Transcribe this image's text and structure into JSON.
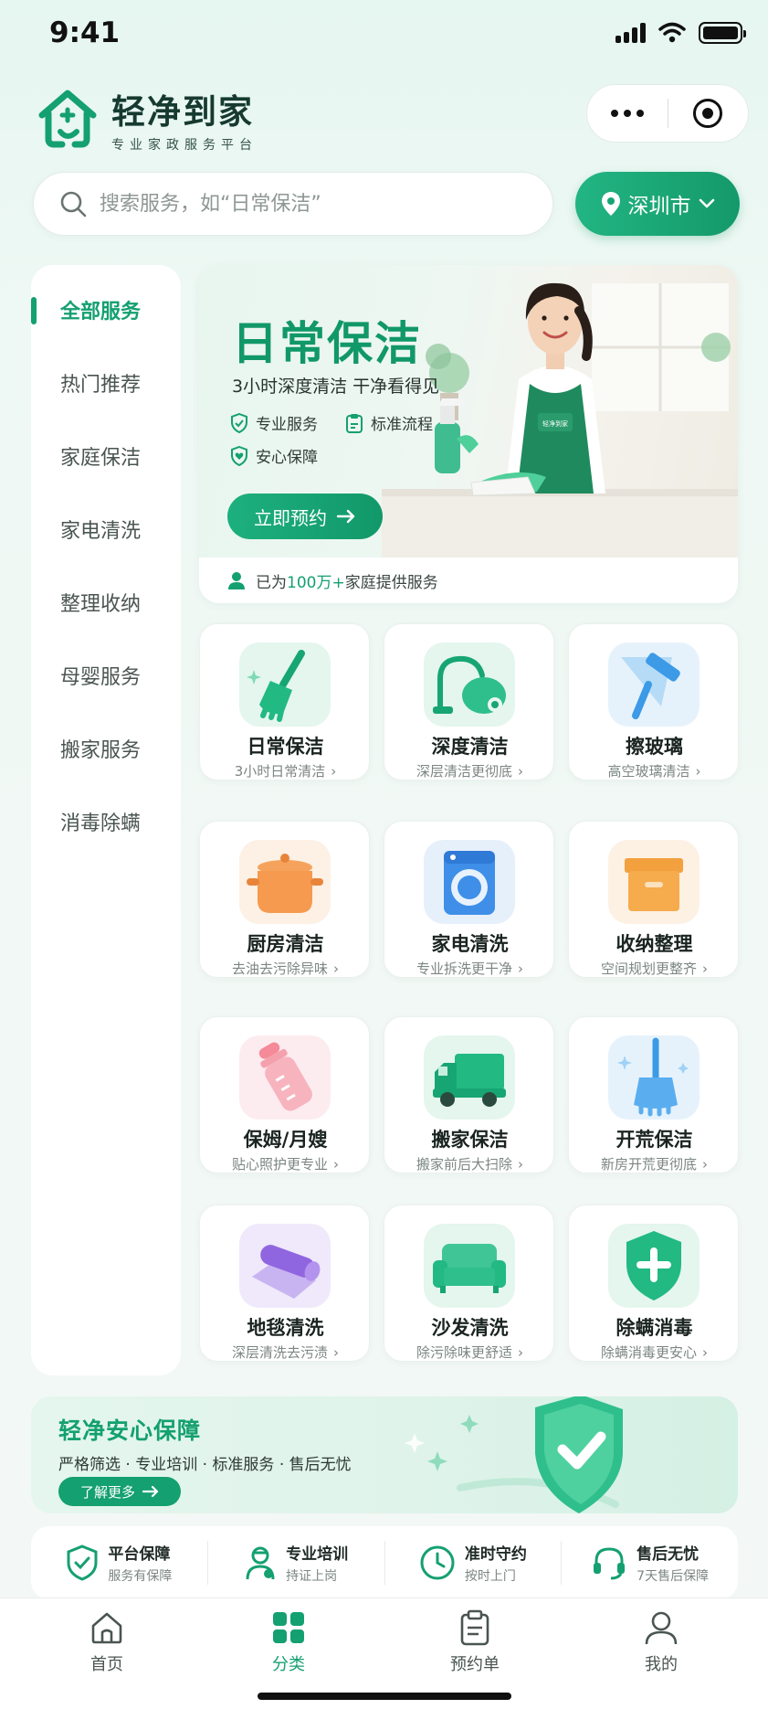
{
  "status_bar": {
    "time": "9:41"
  },
  "brand": {
    "name": "轻净到家",
    "subtitle": "专业家政服务平台"
  },
  "search": {
    "placeholder": "搜索服务，如“日常保洁”",
    "value": ""
  },
  "location": {
    "city": "深圳市"
  },
  "sidebar": {
    "items": [
      {
        "label": "全部服务",
        "active": true
      },
      {
        "label": "热门推荐"
      },
      {
        "label": "家庭保洁"
      },
      {
        "label": "家电清洗"
      },
      {
        "label": "整理收纳"
      },
      {
        "label": "母婴服务"
      },
      {
        "label": "搬家服务"
      },
      {
        "label": "消毒除螨"
      }
    ]
  },
  "banner": {
    "title": "日常保洁",
    "subtitle": "3小时深度清洁  干净看得见",
    "tags": [
      "专业服务",
      "标准流程",
      "安心保障"
    ],
    "button": "立即预约",
    "footer_prefix": "已为",
    "footer_highlight": "100万+",
    "footer_suffix": "家庭提供服务",
    "apron_logo": "轻净到家"
  },
  "services": [
    {
      "title": "日常保洁",
      "sub": "3小时日常清洁",
      "icon": "broom-icon"
    },
    {
      "title": "深度清洁",
      "sub": "深层清洁更彻底",
      "icon": "vacuum-icon"
    },
    {
      "title": "擦玻璃",
      "sub": "高空玻璃清洁",
      "icon": "squeegee-icon"
    },
    {
      "title": "厨房清洁",
      "sub": "去油去污除异味",
      "icon": "pot-icon"
    },
    {
      "title": "家电清洗",
      "sub": "专业拆洗更干净",
      "icon": "washing-machine-icon"
    },
    {
      "title": "收纳整理",
      "sub": "空间规划更整齐",
      "icon": "storage-box-icon"
    },
    {
      "title": "保姆/月嫂",
      "sub": "贴心照护更专业",
      "icon": "baby-bottle-icon"
    },
    {
      "title": "搬家保洁",
      "sub": "搬家前后大扫除",
      "icon": "truck-icon"
    },
    {
      "title": "开荒保洁",
      "sub": "新房开荒更彻底",
      "icon": "sparkle-broom-icon"
    },
    {
      "title": "地毯清洗",
      "sub": "深层清洗去污渍",
      "icon": "carpet-roll-icon"
    },
    {
      "title": "沙发清洗",
      "sub": "除污除味更舒适",
      "icon": "sofa-icon"
    },
    {
      "title": "除螨消毒",
      "sub": "除螨消毒更安心",
      "icon": "shield-plus-icon"
    }
  ],
  "guarantee": {
    "title": "轻净安心保障",
    "subtitle": "严格筛选 · 专业培训 · 标准服务 · 售后无忧",
    "button": "了解更多"
  },
  "features": [
    {
      "title": "平台保障",
      "sub": "服务有保障",
      "icon": "shield-check-icon"
    },
    {
      "title": "专业培训",
      "sub": "持证上岗",
      "icon": "worker-icon"
    },
    {
      "title": "准时守约",
      "sub": "按时上门",
      "icon": "clock-icon"
    },
    {
      "title": "售后无忧",
      "sub": "7天售后保障",
      "icon": "headset-icon"
    }
  ],
  "tabbar": [
    {
      "label": "首页",
      "icon": "home-icon"
    },
    {
      "label": "分类",
      "icon": "grid-icon",
      "active": true
    },
    {
      "label": "预约单",
      "icon": "clipboard-icon"
    },
    {
      "label": "我的",
      "icon": "user-icon"
    }
  ],
  "colors": {
    "brand": "#14a070",
    "brand_dark": "#119868",
    "background": "#eef8f4"
  }
}
